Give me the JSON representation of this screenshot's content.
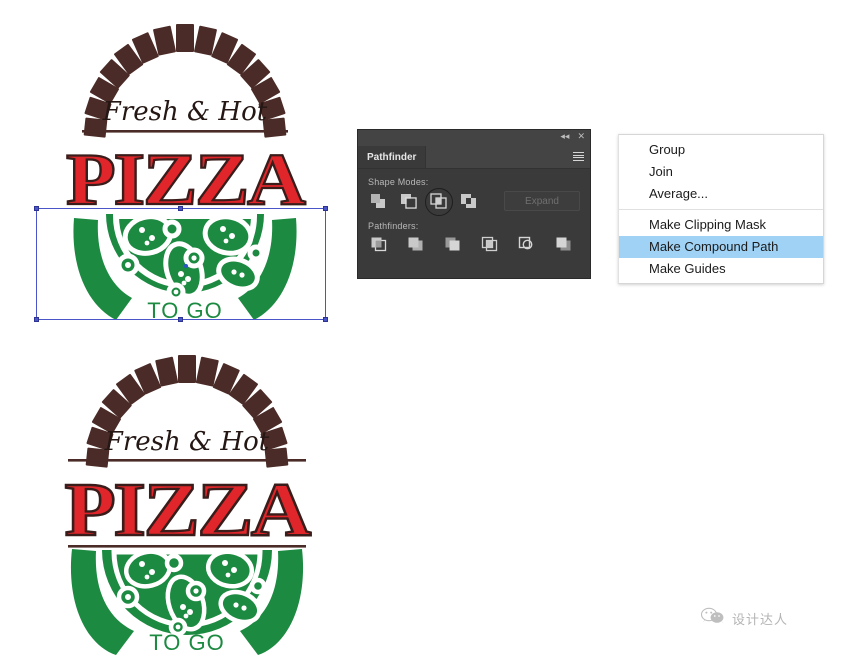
{
  "app": {
    "context": "Adobe Illustrator artboard with Pathfinder panel and right-click context menu"
  },
  "pathfinder_panel": {
    "tab_label": "Pathfinder",
    "collapse_icon": "double-chevron-left-icon",
    "close_icon": "close-icon",
    "menu_icon": "panel-menu-icon",
    "shape_modes_label": "Shape Modes:",
    "pathfinders_label": "Pathfinders:",
    "expand_label": "Expand",
    "expand_enabled": false,
    "shape_modes": [
      {
        "name": "unite",
        "label": "Unite",
        "selected": false
      },
      {
        "name": "minus-front",
        "label": "Minus Front",
        "selected": false
      },
      {
        "name": "intersect",
        "label": "Intersect",
        "selected": true
      },
      {
        "name": "exclude",
        "label": "Exclude",
        "selected": false
      }
    ],
    "pathfinders": [
      {
        "name": "divide",
        "label": "Divide"
      },
      {
        "name": "trim",
        "label": "Trim"
      },
      {
        "name": "merge",
        "label": "Merge"
      },
      {
        "name": "crop",
        "label": "Crop"
      },
      {
        "name": "outline",
        "label": "Outline"
      },
      {
        "name": "minus-back",
        "label": "Minus Back"
      }
    ]
  },
  "context_menu": {
    "groups": [
      {
        "items": [
          {
            "label": "Group",
            "selected": false
          },
          {
            "label": "Join",
            "selected": false
          },
          {
            "label": "Average...",
            "selected": false
          }
        ]
      },
      {
        "items": [
          {
            "label": "Make Clipping Mask",
            "selected": false
          },
          {
            "label": "Make Compound Path",
            "selected": true
          },
          {
            "label": "Make Guides",
            "selected": false
          }
        ]
      }
    ]
  },
  "artwork": {
    "top_logo": {
      "headline_script": "Fresh & Hot",
      "wordmark": "PIZZA",
      "tagline": "TO GO",
      "selected": true
    },
    "bottom_logo": {
      "headline_script": "Fresh & Hot",
      "wordmark": "PIZZA",
      "tagline": "TO GO",
      "selected": false
    }
  },
  "watermark": {
    "icon": "wechat-icon",
    "text": "设计达人"
  },
  "colors": {
    "brand_green": "#1c8a41",
    "brand_red": "#e0262b",
    "brand_brown": "#4a2b27",
    "selection_blue": "#4a55c8",
    "menu_highlight": "#9fd2f5",
    "panel_bg": "#3a3a3a"
  }
}
